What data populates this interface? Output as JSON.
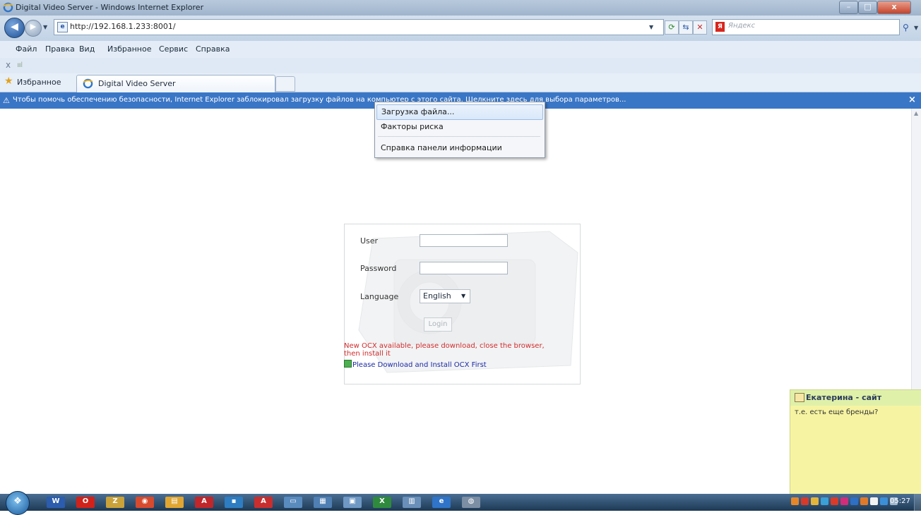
{
  "window": {
    "title": "Digital Video Server - Windows Internet Explorer",
    "minimize_label": "–",
    "maximize_label": "□",
    "close_label": "x"
  },
  "address_bar": {
    "url": "http://192.168.1.233:8001/",
    "search_placeholder": "Яндекс",
    "search_logo": "Я"
  },
  "menu": [
    "Файл",
    "Правка",
    "Вид",
    "Избранное",
    "Сервис",
    "Справка"
  ],
  "command_bar": {
    "close_label": "x",
    "signal_label": "ıııl"
  },
  "favorites_bar": {
    "favorites_label": "Избранное"
  },
  "tab": {
    "title": "Digital Video Server"
  },
  "info_bar": {
    "text": "Чтобы помочь обеспечению безопасности, Internet Explorer заблокировал загрузку файлов на компьютер с этого сайта. Щелкните здесь для выбора параметров...",
    "close_label": "×"
  },
  "context_menu": {
    "items": [
      "Загрузка файла...",
      "Факторы риска",
      "Справка панели информации"
    ]
  },
  "login": {
    "user_label": "User",
    "password_label": "Password",
    "language_label": "Language",
    "language_value": "English",
    "login_button": "Login",
    "ocx_message": "New OCX available, please download, close the browser, then install it",
    "ocx_link": "Please Download and Install OCX First"
  },
  "chat": {
    "name": "Екатерина - сайт",
    "message": "т.е. есть еще бренды?"
  },
  "taskbar": {
    "clock": "05:27",
    "apps": [
      {
        "name": "word",
        "color": "#2b5cae",
        "glyph": "W"
      },
      {
        "name": "opera",
        "color": "#d0221a",
        "glyph": "O"
      },
      {
        "name": "app3",
        "color": "#c9a23a",
        "glyph": "Z"
      },
      {
        "name": "chrome",
        "color": "#d64a2e",
        "glyph": "◉"
      },
      {
        "name": "explorer-folder",
        "color": "#e0a631",
        "glyph": "▤"
      },
      {
        "name": "acrobat",
        "color": "#c0262a",
        "glyph": "A"
      },
      {
        "name": "app7",
        "color": "#2e7dc2",
        "glyph": "▪"
      },
      {
        "name": "app8",
        "color": "#c92e2e",
        "glyph": "A"
      },
      {
        "name": "app9",
        "color": "#5a8bbf",
        "glyph": "▭"
      },
      {
        "name": "app10",
        "color": "#4f7fb3",
        "glyph": "▦"
      },
      {
        "name": "app11",
        "color": "#6f98c4",
        "glyph": "▣"
      },
      {
        "name": "excel",
        "color": "#2f8a3d",
        "glyph": "X"
      },
      {
        "name": "app13",
        "color": "#6a8fb8",
        "glyph": "▥"
      },
      {
        "name": "internet-explorer",
        "color": "#2f74c8",
        "glyph": "e"
      },
      {
        "name": "app15",
        "color": "#7c8ea3",
        "glyph": "◍"
      }
    ],
    "tray": [
      "#e6862a",
      "#d53a2a",
      "#e3b53a",
      "#3aa0d6",
      "#d93a2a",
      "#d12d7b",
      "#2f6fc4",
      "#e07a2a",
      "#f2f2f2",
      "#3b8fd6",
      "#9fb6cc"
    ]
  },
  "colors": {
    "info_bar_bg": "#3a76c6",
    "ocx_error": "#d12b2b",
    "chat_bg": "#f6f4a2"
  }
}
